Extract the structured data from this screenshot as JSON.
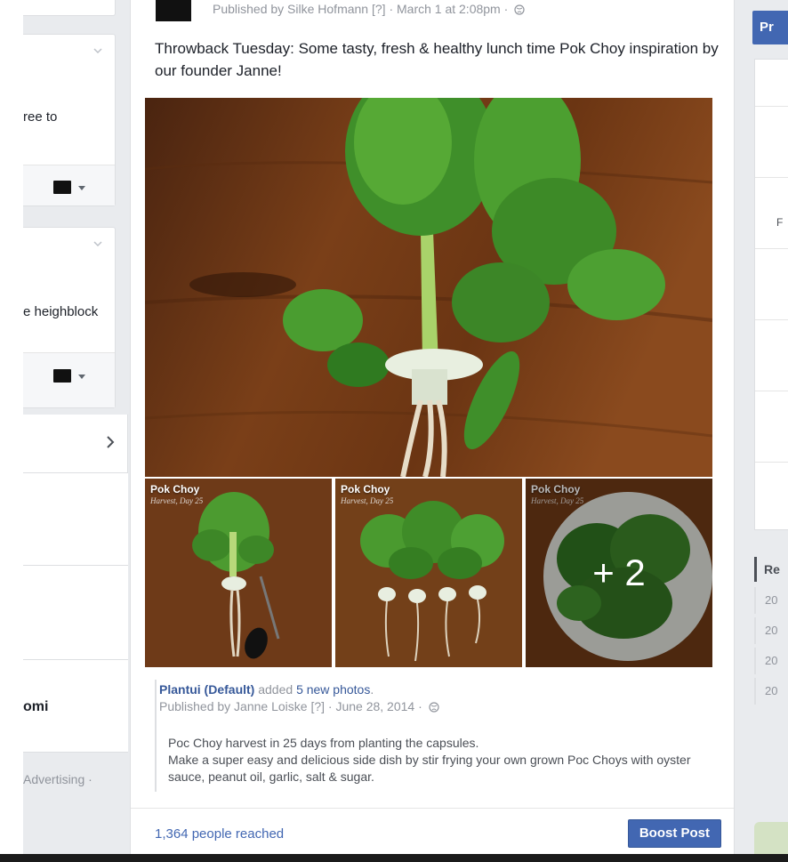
{
  "left_column": {
    "card1_snippet": "ree to",
    "card2_snippet": "e heighblock",
    "bold_snippet": "omi",
    "footer_snippet": "Advertising ·"
  },
  "post": {
    "published_line": "Published by Silke Hofmann [?] · March 1 at 2:08pm ·",
    "caption": "Throwback Tuesday: Some tasty, fresh & healthy lunch time Pok Choy inspiration by our founder Janne!",
    "photos": {
      "thumb1_label": "Pok Choy",
      "thumb1_sub": "Harvest, Day 25",
      "thumb2_label": "Pok Choy",
      "thumb2_sub": "Harvest, Day 25",
      "thumb3_label": "Pok Choy",
      "thumb3_sub": "Harvest, Day 25",
      "more_count": "+ 2"
    },
    "shared": {
      "page_name": "Plantui (Default)",
      "action_text": "added",
      "photos_link": "5 new photos",
      "published_line": "Published by Janne Loiske [?] · June 28, 2014 ·",
      "description_line1": "Poc Choy harvest in 25 days from planting the capsules.",
      "description_line2": "Make a super easy and delicious side dish by stir frying your own grown Poc Choys with oyster sauce, peanut oil, garlic, salt & sugar."
    },
    "reach": "1,364 people reached",
    "boost_label": "Boost Post"
  },
  "right_column": {
    "button_label": "Pr",
    "panel_snippet": "F",
    "list_head": "Re",
    "list_items": [
      "20",
      "20",
      "20",
      "20"
    ]
  },
  "colors": {
    "brand": "#4267b2",
    "link": "#365899",
    "muted": "#90949c",
    "background": "#e9ebee"
  }
}
